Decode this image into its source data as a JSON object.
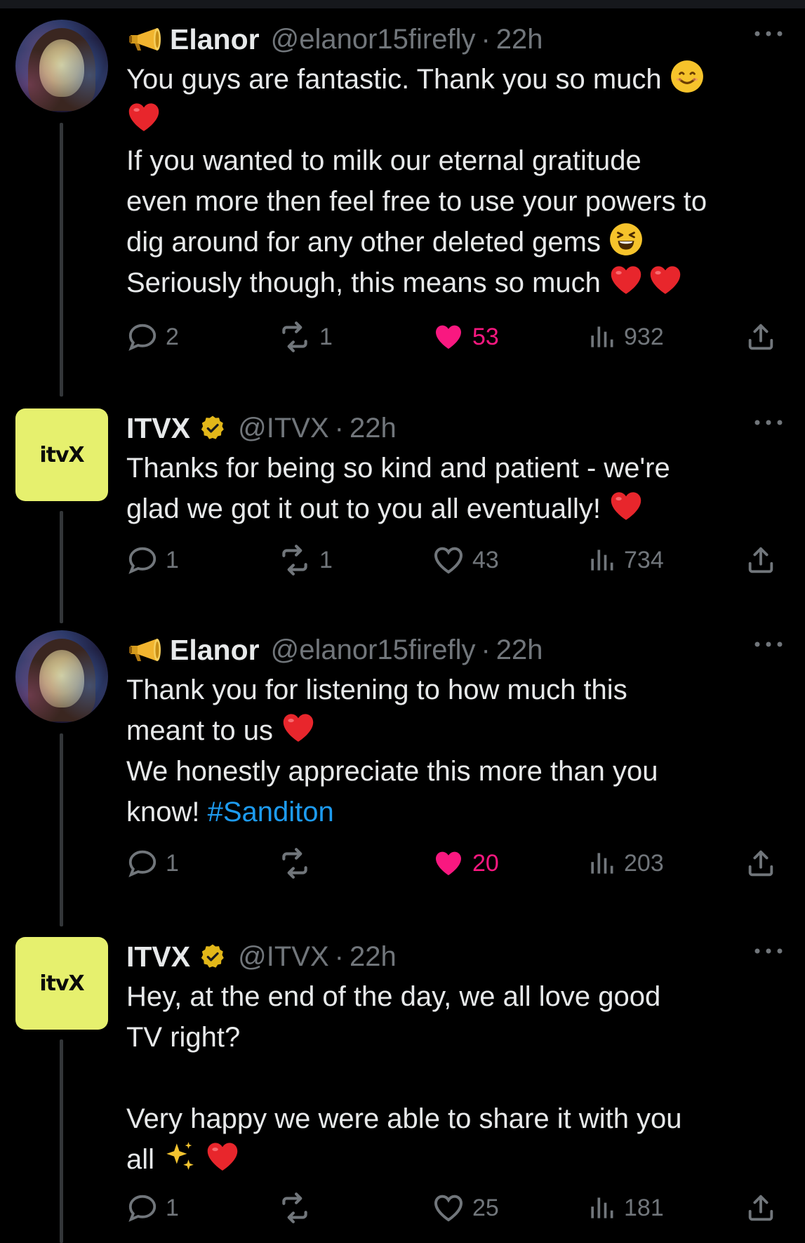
{
  "tweets": [
    {
      "author": "Elanor",
      "handle": "@elanor15firefly",
      "time": "22h",
      "text_lines": [
        "You guys are fantastic. Thank you so much",
        "If you wanted to milk our eternal gratitude",
        "even more then feel free to use your powers to",
        "dig around for any other deleted gems",
        "Seriously though, this means so much"
      ],
      "replies": "2",
      "retweets": "1",
      "likes": "53",
      "views": "932",
      "liked": true
    },
    {
      "author": "ITVX",
      "verified": true,
      "handle": "@ITVX",
      "time": "22h",
      "avatar_text": "itvX",
      "text_lines": [
        "Thanks for being so kind and patient - we're",
        "glad we got it out to you all eventually!"
      ],
      "replies": "1",
      "retweets": "1",
      "likes": "43",
      "views": "734",
      "liked": false
    },
    {
      "author": "Elanor",
      "handle": "@elanor15firefly",
      "time": "22h",
      "text_lines": [
        "Thank you for listening to how much this",
        "meant to us",
        "We honestly appreciate this more than you",
        "know!"
      ],
      "hashtag": "#Sanditon",
      "replies": "1",
      "retweets": "",
      "likes": "20",
      "views": "203",
      "liked": true
    },
    {
      "author": "ITVX",
      "verified": true,
      "handle": "@ITVX",
      "time": "22h",
      "avatar_text": "itvX",
      "text_lines": [
        "Hey, at the end of the day, we all love good",
        "TV right?",
        "Very happy we were able to share it with you",
        "all"
      ],
      "replies": "1",
      "retweets": "",
      "likes": "25",
      "views": "181",
      "liked": false
    }
  ],
  "colors": {
    "background": "#000000",
    "text": "#e7e9ea",
    "muted": "#71767b",
    "like": "#f91880",
    "link": "#1d9bf0",
    "itvx_brand": "#e6f06e",
    "verified_gold": "#e2b719"
  },
  "icons": [
    "megaphone-icon",
    "verified-badge-icon",
    "more-icon",
    "reply-icon",
    "retweet-icon",
    "like-icon",
    "views-icon",
    "share-icon",
    "heart-emoji",
    "smile-emoji",
    "laughing-emoji",
    "sparkles-emoji"
  ]
}
